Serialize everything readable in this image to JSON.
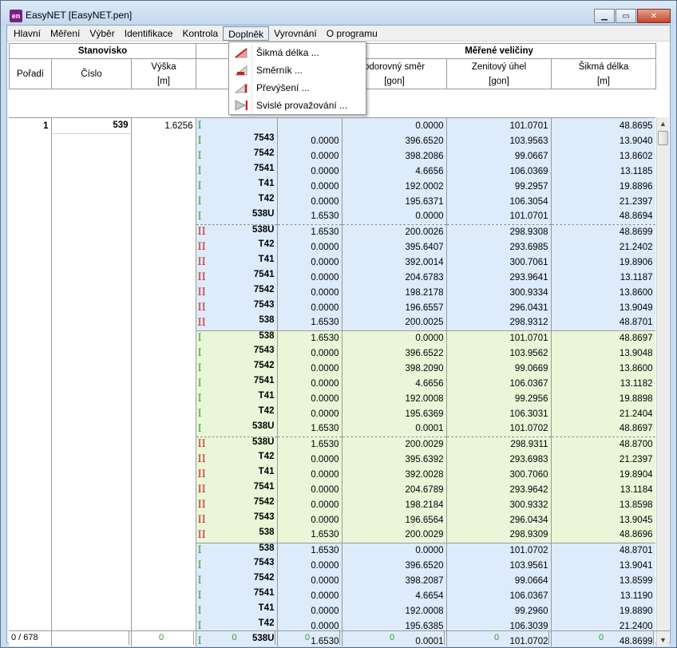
{
  "window": {
    "title": "EasyNET [EasyNET.pen]",
    "icon": "en"
  },
  "menu": [
    "Hlavní",
    "Měření",
    "Výběr",
    "Identifikace",
    "Kontrola",
    "Doplněk",
    "Vyrovnání",
    "O programu"
  ],
  "dropdown": {
    "items": [
      {
        "label": "Šikmá délka ...",
        "icon": "slope-distance-icon"
      },
      {
        "label": "Směrník ...",
        "icon": "bearing-icon"
      },
      {
        "label": "Převýšení ...",
        "icon": "height-difference-icon"
      },
      {
        "label": "Svislé provažování ...",
        "icon": "vertical-plumbing-icon"
      }
    ]
  },
  "header": {
    "group_station": "Stanovisko",
    "group_measured": "Měřené veličiny",
    "col_order": "Pořadí",
    "col_number": "Číslo",
    "col_height": "Výška",
    "col_height_unit": "[m]",
    "col_cislo_partial": "č",
    "col_hz": "odorovný směr",
    "col_hz_unit": "[gon]",
    "col_zen": "Zenitový úhel",
    "col_zen_unit": "[gon]",
    "col_slope": "Šikmá délka",
    "col_slope_unit": "[m]"
  },
  "station": {
    "order": "1",
    "number": "539",
    "height": "1.6256"
  },
  "rows": [
    {
      "face": "I",
      "grp": "blue",
      "pt": "",
      "th": "",
      "hz": "0.0000",
      "zen": "101.0701",
      "sd": "48.8695"
    },
    {
      "face": "I",
      "grp": "blue",
      "pt": "7543",
      "th": "0.0000",
      "hz": "396.6520",
      "zen": "103.9563",
      "sd": "13.9040"
    },
    {
      "face": "I",
      "grp": "blue",
      "pt": "7542",
      "th": "0.0000",
      "hz": "398.2086",
      "zen": "99.0667",
      "sd": "13.8602"
    },
    {
      "face": "I",
      "grp": "blue",
      "pt": "7541",
      "th": "0.0000",
      "hz": "4.6656",
      "zen": "106.0369",
      "sd": "13.1185"
    },
    {
      "face": "I",
      "grp": "blue",
      "pt": "T41",
      "th": "0.0000",
      "hz": "192.0002",
      "zen": "99.2957",
      "sd": "19.8896"
    },
    {
      "face": "I",
      "grp": "blue",
      "pt": "T42",
      "th": "0.0000",
      "hz": "195.6371",
      "zen": "106.3054",
      "sd": "21.2397"
    },
    {
      "face": "I",
      "grp": "blue",
      "pt": "538U",
      "th": "1.6530",
      "hz": "0.0000",
      "zen": "101.0701",
      "sd": "48.8694"
    },
    {
      "face": "II",
      "grp": "blue",
      "dash": true,
      "pt": "538U",
      "th": "1.6530",
      "hz": "200.0026",
      "zen": "298.9308",
      "sd": "48.8699"
    },
    {
      "face": "II",
      "grp": "blue",
      "pt": "T42",
      "th": "0.0000",
      "hz": "395.6407",
      "zen": "293.6985",
      "sd": "21.2402"
    },
    {
      "face": "II",
      "grp": "blue",
      "pt": "T41",
      "th": "0.0000",
      "hz": "392.0014",
      "zen": "300.7061",
      "sd": "19.8906"
    },
    {
      "face": "II",
      "grp": "blue",
      "pt": "7541",
      "th": "0.0000",
      "hz": "204.6783",
      "zen": "293.9641",
      "sd": "13.1187"
    },
    {
      "face": "II",
      "grp": "blue",
      "pt": "7542",
      "th": "0.0000",
      "hz": "198.2178",
      "zen": "300.9334",
      "sd": "13.8600"
    },
    {
      "face": "II",
      "grp": "blue",
      "pt": "7543",
      "th": "0.0000",
      "hz": "196.6557",
      "zen": "296.0431",
      "sd": "13.9049"
    },
    {
      "face": "II",
      "grp": "blue",
      "pt": "538",
      "th": "1.6530",
      "hz": "200.0025",
      "zen": "298.9312",
      "sd": "48.8701"
    },
    {
      "face": "I",
      "grp": "green",
      "first": true,
      "pt": "538",
      "th": "1.6530",
      "hz": "0.0000",
      "zen": "101.0701",
      "sd": "48.8697"
    },
    {
      "face": "I",
      "grp": "green",
      "pt": "7543",
      "th": "0.0000",
      "hz": "396.6522",
      "zen": "103.9562",
      "sd": "13.9048"
    },
    {
      "face": "I",
      "grp": "green",
      "pt": "7542",
      "th": "0.0000",
      "hz": "398.2090",
      "zen": "99.0669",
      "sd": "13.8600"
    },
    {
      "face": "I",
      "grp": "green",
      "pt": "7541",
      "th": "0.0000",
      "hz": "4.6656",
      "zen": "106.0367",
      "sd": "13.1182"
    },
    {
      "face": "I",
      "grp": "green",
      "pt": "T41",
      "th": "0.0000",
      "hz": "192.0008",
      "zen": "99.2956",
      "sd": "19.8898"
    },
    {
      "face": "I",
      "grp": "green",
      "pt": "T42",
      "th": "0.0000",
      "hz": "195.6369",
      "zen": "106.3031",
      "sd": "21.2404"
    },
    {
      "face": "I",
      "grp": "green",
      "pt": "538U",
      "th": "1.6530",
      "hz": "0.0001",
      "zen": "101.0702",
      "sd": "48.8697"
    },
    {
      "face": "II",
      "grp": "green",
      "dash": true,
      "pt": "538U",
      "th": "1.6530",
      "hz": "200.0029",
      "zen": "298.9311",
      "sd": "48.8700"
    },
    {
      "face": "II",
      "grp": "green",
      "pt": "T42",
      "th": "0.0000",
      "hz": "395.6392",
      "zen": "293.6983",
      "sd": "21.2397"
    },
    {
      "face": "II",
      "grp": "green",
      "pt": "T41",
      "th": "0.0000",
      "hz": "392.0028",
      "zen": "300.7060",
      "sd": "19.8904"
    },
    {
      "face": "II",
      "grp": "green",
      "pt": "7541",
      "th": "0.0000",
      "hz": "204.6789",
      "zen": "293.9642",
      "sd": "13.1184"
    },
    {
      "face": "II",
      "grp": "green",
      "pt": "7542",
      "th": "0.0000",
      "hz": "198.2184",
      "zen": "300.9332",
      "sd": "13.8598"
    },
    {
      "face": "II",
      "grp": "green",
      "pt": "7543",
      "th": "0.0000",
      "hz": "196.6564",
      "zen": "296.0434",
      "sd": "13.9045"
    },
    {
      "face": "II",
      "grp": "green",
      "pt": "538",
      "th": "1.6530",
      "hz": "200.0029",
      "zen": "298.9309",
      "sd": "48.8696"
    },
    {
      "face": "I",
      "grp": "blue",
      "first": true,
      "pt": "538",
      "th": "1.6530",
      "hz": "0.0000",
      "zen": "101.0702",
      "sd": "48.8701"
    },
    {
      "face": "I",
      "grp": "blue",
      "pt": "7543",
      "th": "0.0000",
      "hz": "396.6520",
      "zen": "103.9561",
      "sd": "13.9041"
    },
    {
      "face": "I",
      "grp": "blue",
      "pt": "7542",
      "th": "0.0000",
      "hz": "398.2087",
      "zen": "99.0664",
      "sd": "13.8599"
    },
    {
      "face": "I",
      "grp": "blue",
      "pt": "7541",
      "th": "0.0000",
      "hz": "4.6654",
      "zen": "106.0367",
      "sd": "13.1190"
    },
    {
      "face": "I",
      "grp": "blue",
      "pt": "T41",
      "th": "0.0000",
      "hz": "192.0008",
      "zen": "99.2960",
      "sd": "19.8890"
    },
    {
      "face": "I",
      "grp": "blue",
      "pt": "T42",
      "th": "0.0000",
      "hz": "195.6385",
      "zen": "106.3039",
      "sd": "21.2400"
    },
    {
      "face": "I",
      "grp": "blue",
      "pt": "538U",
      "th": "1.6530",
      "hz": "0.0001",
      "zen": "101.0702",
      "sd": "48.8699"
    }
  ],
  "footer": {
    "count": "0 / 678",
    "zeros": [
      "0",
      "0",
      "0",
      "0",
      "0",
      "0"
    ]
  },
  "colors": {
    "blue_group": "#deebfb",
    "green_group": "#e9f7d8",
    "face_I": "#3a9a3a",
    "face_II": "#c62020"
  }
}
